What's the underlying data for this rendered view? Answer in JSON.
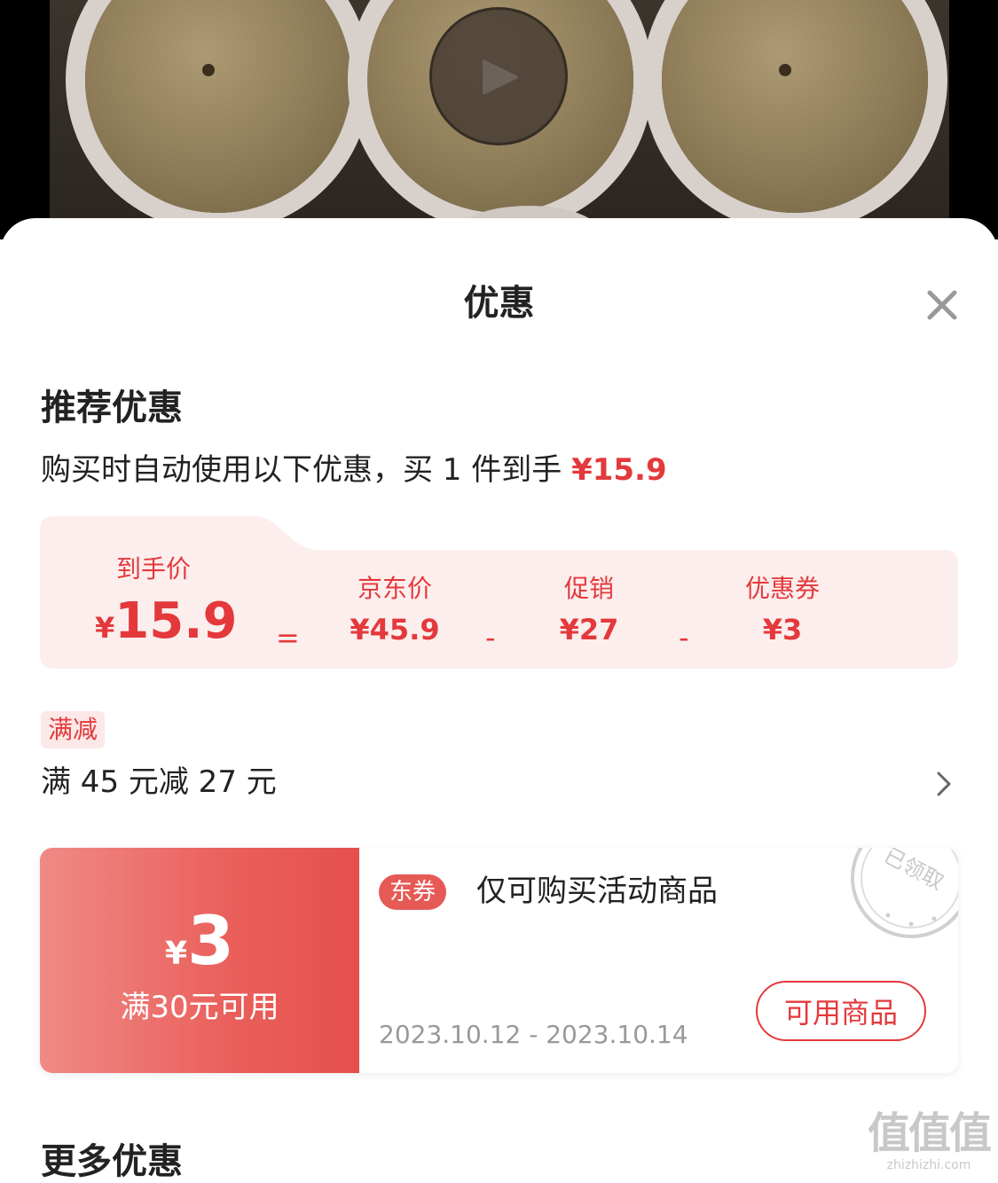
{
  "sheet": {
    "title": "优惠"
  },
  "recommended": {
    "title": "推荐优惠",
    "subline_text": "购买时自动使用以下优惠，买 1 件到手 ",
    "subline_price": "¥15.9"
  },
  "breakdown": {
    "final_label": "到手价",
    "final_currency": "¥",
    "final_value": "15.9",
    "equals": "=",
    "minus": "-",
    "items": [
      {
        "label": "京东价",
        "value": "¥45.9"
      },
      {
        "label": "促销",
        "value": "¥27"
      },
      {
        "label": "优惠券",
        "value": "¥3"
      }
    ]
  },
  "promotion": {
    "tag": "满减",
    "text": "满 45 元减 27 元"
  },
  "coupon": {
    "currency": "¥",
    "amount": "3",
    "condition": "满30元可用",
    "badge": "东券",
    "title": "仅可购买活动商品",
    "date_range": "2023.10.12 - 2023.10.14",
    "button": "可用商品",
    "stamp_text": "已领取"
  },
  "more": {
    "title": "更多优惠"
  },
  "watermark": {
    "big": "值值值",
    "small": "zhizhizhi.com"
  },
  "colors": {
    "accent": "#e4393c",
    "pink_bg": "#fdeeee"
  },
  "icons": {
    "play": "play-icon",
    "close": "close-icon",
    "chevron": "chevron-right-icon"
  }
}
